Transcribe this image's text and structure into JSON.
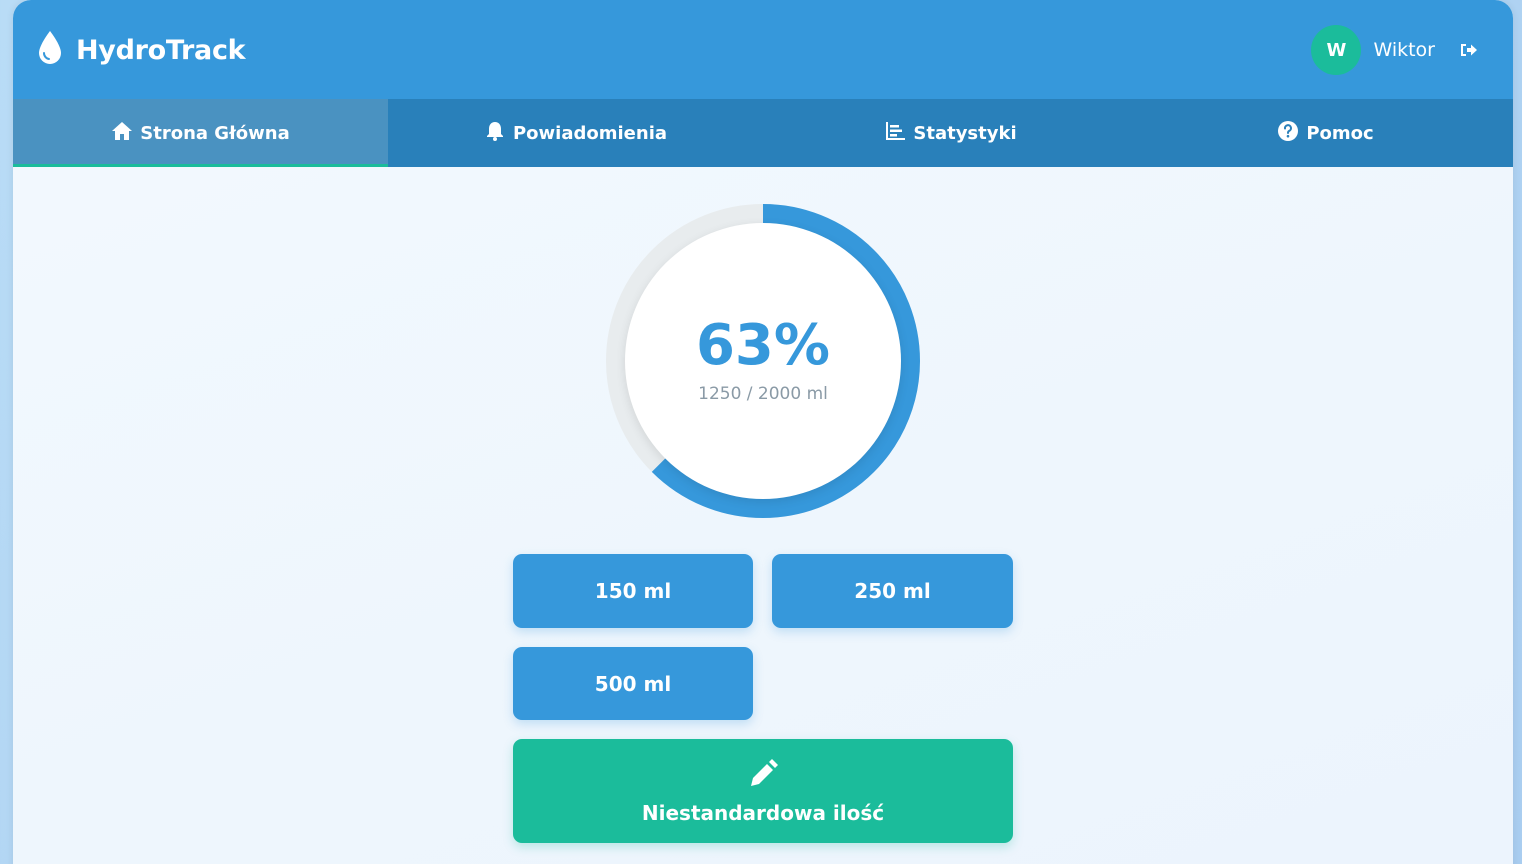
{
  "app": {
    "title": "HydroTrack"
  },
  "user": {
    "initial": "W",
    "name": "Wiktor"
  },
  "nav": {
    "tabs": [
      {
        "label": "Strona Główna",
        "icon": "home-icon",
        "active": true
      },
      {
        "label": "Powiadomienia",
        "icon": "bell-icon",
        "active": false
      },
      {
        "label": "Statystyki",
        "icon": "chart-icon",
        "active": false
      },
      {
        "label": "Pomoc",
        "icon": "question-circle-icon",
        "active": false
      }
    ]
  },
  "progress": {
    "percent_label": "63%",
    "amount_label": "1250 / 2000 ml",
    "fraction": 0.625
  },
  "quick_add": {
    "buttons": [
      {
        "label": "150 ml"
      },
      {
        "label": "250 ml"
      },
      {
        "label": "500 ml"
      }
    ],
    "custom_label": "Niestandardowa ilość"
  },
  "colors": {
    "primary": "#3698db",
    "nav": "#2980ba",
    "accent": "#1bbc9b",
    "ring_track": "#e8ecee"
  }
}
